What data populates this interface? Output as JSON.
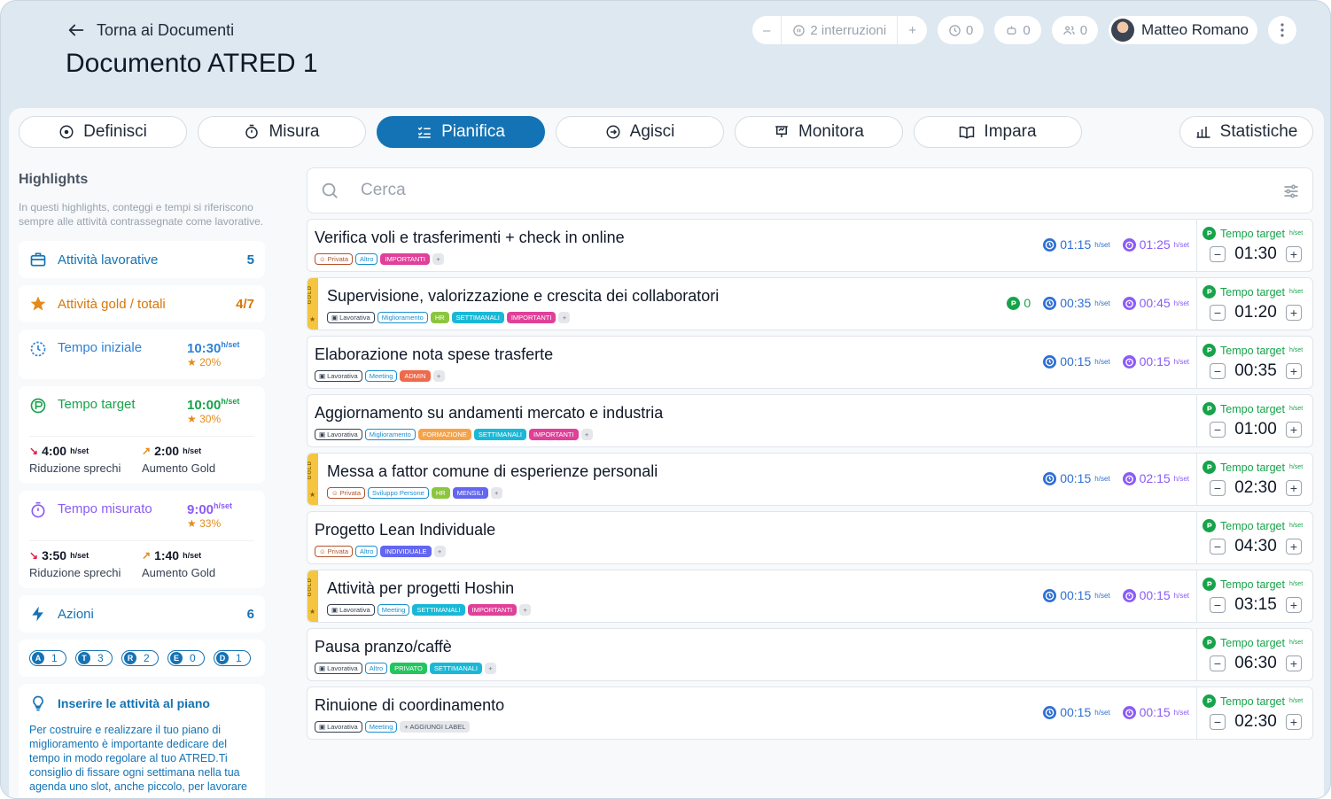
{
  "header": {
    "back_label": "Torna ai Documenti",
    "title": "Documento ATRED 1"
  },
  "toolbar": {
    "interruptions": "2 interruzioni",
    "clock_count": "0",
    "robot_count": "0",
    "people_count": "0",
    "user_name": "Matteo Romano"
  },
  "tabs": [
    {
      "label": "Definisci",
      "icon": "target-icon"
    },
    {
      "label": "Misura",
      "icon": "stopwatch-icon"
    },
    {
      "label": "Pianifica",
      "icon": "checklist-icon",
      "active": true
    },
    {
      "label": "Agisci",
      "icon": "arrow-circle-icon"
    },
    {
      "label": "Monitora",
      "icon": "presentation-icon"
    },
    {
      "label": "Impara",
      "icon": "book-icon"
    }
  ],
  "stats_tab": "Statistiche",
  "sidebar": {
    "title": "Highlights",
    "desc": "In questi highlights, conteggi e tempi si riferiscono sempre alle attività contrassegnate come lavorative.",
    "lavorative": {
      "label": "Attività lavorative",
      "value": "5"
    },
    "gold": {
      "label": "Attività gold / totali",
      "value": "4/7"
    },
    "tempo_iniziale": {
      "label": "Tempo iniziale",
      "value": "10:30",
      "unit": "h/set",
      "pct": "20%"
    },
    "tempo_target": {
      "label": "Tempo target",
      "value": "10:00",
      "unit": "h/set",
      "pct": "30%",
      "riduzione": {
        "value": "4:00",
        "label": "Riduzione sprechi"
      },
      "aumento": {
        "value": "2:00",
        "label": "Aumento Gold"
      }
    },
    "tempo_misurato": {
      "label": "Tempo misurato",
      "value": "9:00",
      "unit": "h/set",
      "pct": "33%",
      "riduzione": {
        "value": "3:50",
        "label": "Riduzione sprechi"
      },
      "aumento": {
        "value": "1:40",
        "label": "Aumento Gold"
      }
    },
    "azioni": {
      "label": "Azioni",
      "value": "6"
    },
    "badges": [
      {
        "letter": "A",
        "count": "1"
      },
      {
        "letter": "T",
        "count": "3"
      },
      {
        "letter": "R",
        "count": "2"
      },
      {
        "letter": "E",
        "count": "0"
      },
      {
        "letter": "D",
        "count": "1"
      }
    ],
    "info": {
      "title": "Inserire le attività al piano",
      "text": "Per costruire e realizzare il tuo piano di miglioramento è importante dedicare del tempo in modo regolare al tuo ATRED.Ti consiglio di fissare ogni settimana nella tua agenda uno slot, anche piccolo, per lavorare"
    }
  },
  "search": {
    "placeholder": "Cerca"
  },
  "unit": "h/set",
  "target_label": "Tempo target",
  "gold_label": "GOLD",
  "activities": [
    {
      "name": "Verifica voli e trasferimenti + check in online",
      "gold": false,
      "tags": [
        {
          "t": "Privata",
          "k": "priv",
          "icon": true
        },
        {
          "t": "Altro",
          "k": "out"
        },
        {
          "t": "IMPORTANTI",
          "k": "fill",
          "c": "#e0409a"
        },
        {
          "t": "+",
          "k": "plus"
        }
      ],
      "t1": "01:15",
      "t2": "01:25",
      "target": "01:30"
    },
    {
      "name": "Supervisione, valorizzazione e crescita dei collaboratori",
      "gold": true,
      "tags": [
        {
          "t": "Lavorativa",
          "k": "lav",
          "icon": true
        },
        {
          "t": "Miglioramento",
          "k": "out"
        },
        {
          "t": "HR",
          "k": "fill",
          "c": "#8cc63f"
        },
        {
          "t": "SETTIMANALI",
          "k": "fill",
          "c": "#19b8d6"
        },
        {
          "t": "IMPORTANTI",
          "k": "fill",
          "c": "#e0409a"
        },
        {
          "t": "+",
          "k": "plus"
        }
      ],
      "t0": "0",
      "t1": "00:35",
      "t2": "00:45",
      "target": "01:20"
    },
    {
      "name": "Elaborazione nota spese trasferte",
      "gold": false,
      "tags": [
        {
          "t": "Lavorativa",
          "k": "lav",
          "icon": true
        },
        {
          "t": "Meeting",
          "k": "out"
        },
        {
          "t": "ADMIN",
          "k": "fill",
          "c": "#ef6a4a"
        },
        {
          "t": "+",
          "k": "plus"
        }
      ],
      "t1": "00:15",
      "t2": "00:15",
      "target": "00:35"
    },
    {
      "name": "Aggiornamento su andamenti mercato e industria",
      "gold": false,
      "tags": [
        {
          "t": "Lavorativa",
          "k": "lav",
          "icon": true
        },
        {
          "t": "Miglioramento",
          "k": "out"
        },
        {
          "t": "FORMAZIONE",
          "k": "fill",
          "c": "#f5a34b"
        },
        {
          "t": "SETTIMANALI",
          "k": "fill",
          "c": "#19b8d6"
        },
        {
          "t": "IMPORTANTI",
          "k": "fill",
          "c": "#e0409a"
        },
        {
          "t": "+",
          "k": "plus"
        }
      ],
      "target": "01:00"
    },
    {
      "name": "Messa a fattor comune di esperienze personali",
      "gold": true,
      "tags": [
        {
          "t": "Privata",
          "k": "priv",
          "icon": true
        },
        {
          "t": "Sviluppo Persone",
          "k": "out"
        },
        {
          "t": "HR",
          "k": "fill",
          "c": "#8cc63f"
        },
        {
          "t": "MENSILI",
          "k": "fill",
          "c": "#6366f1"
        },
        {
          "t": "+",
          "k": "plus"
        }
      ],
      "t1": "00:15",
      "t2": "02:15",
      "target": "02:30"
    },
    {
      "name": "Progetto Lean Individuale",
      "gold": false,
      "tags": [
        {
          "t": "Privata",
          "k": "priv",
          "icon": true
        },
        {
          "t": "Altro",
          "k": "out"
        },
        {
          "t": "INDIVIDUALE",
          "k": "fill",
          "c": "#6366f1"
        },
        {
          "t": "+",
          "k": "plus"
        }
      ],
      "target": "04:30"
    },
    {
      "name": "Attività per progetti Hoshin",
      "gold": true,
      "tags": [
        {
          "t": "Lavorativa",
          "k": "lav",
          "icon": true
        },
        {
          "t": "Meeting",
          "k": "out"
        },
        {
          "t": "SETTIMANALI",
          "k": "fill",
          "c": "#19b8d6"
        },
        {
          "t": "IMPORTANTI",
          "k": "fill",
          "c": "#e0409a"
        },
        {
          "t": "+",
          "k": "plus"
        }
      ],
      "t1": "00:15",
      "t2": "00:15",
      "target": "03:15"
    },
    {
      "name": "Pausa pranzo/caffè",
      "gold": false,
      "tags": [
        {
          "t": "Lavorativa",
          "k": "lav",
          "icon": true
        },
        {
          "t": "Altro",
          "k": "out"
        },
        {
          "t": "PRIVATO",
          "k": "fill",
          "c": "#22c55e"
        },
        {
          "t": "SETTIMANALI",
          "k": "fill",
          "c": "#19b8d6"
        },
        {
          "t": "+",
          "k": "plus"
        }
      ],
      "target": "06:30"
    },
    {
      "name": "Rinuione di coordinamento",
      "gold": false,
      "tags": [
        {
          "t": "Lavorativa",
          "k": "lav",
          "icon": true
        },
        {
          "t": "Meeting",
          "k": "out"
        },
        {
          "t": "+ AGGIUNGI LABEL",
          "k": "add"
        }
      ],
      "t1": "00:15",
      "t2": "00:15",
      "target": "02:30"
    }
  ]
}
